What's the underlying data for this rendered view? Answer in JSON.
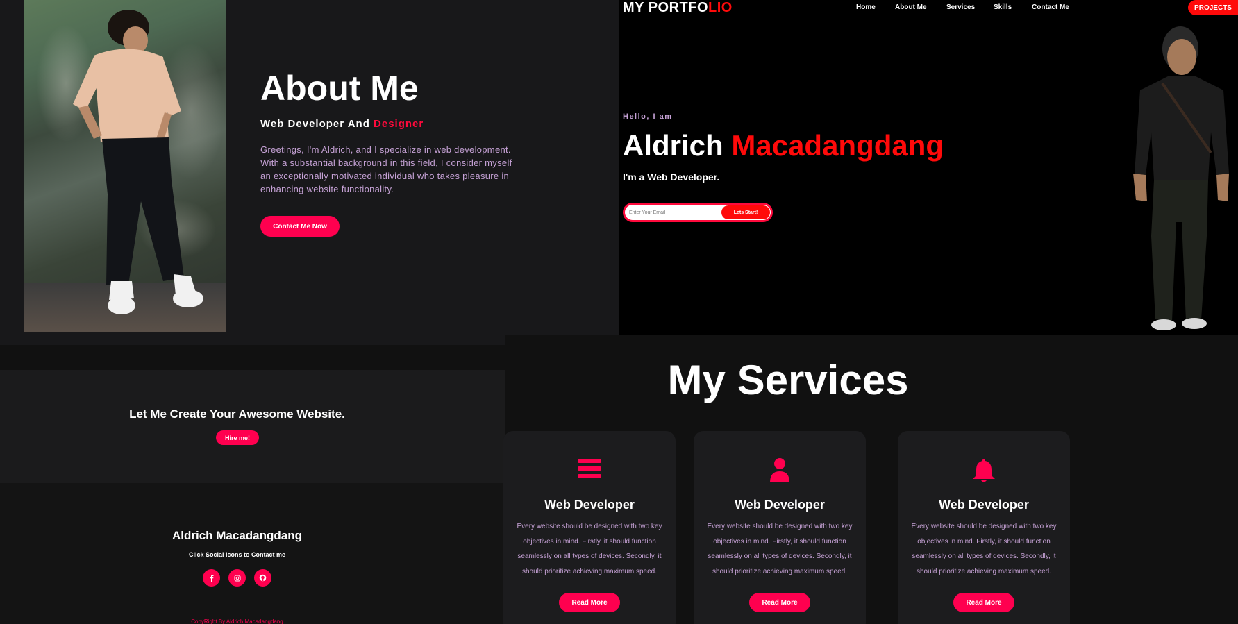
{
  "about": {
    "heading": "About Me",
    "subtitle_main": "Web Developer And ",
    "subtitle_accent": "Designer",
    "description": "Greetings, I'm Aldrich, and I specialize in web development. With a substantial background in this field, I consider myself an exceptionally motivated individual who takes pleasure in enhancing website functionality.",
    "button_label": "Contact Me Now"
  },
  "hero": {
    "logo_main": "MY PORTFO",
    "logo_accent": "LIO",
    "nav": [
      "Home",
      "About Me",
      "Services",
      "Skills",
      "Contact Me"
    ],
    "projects_label": "PROJECTS",
    "greeting": "Hello, I am",
    "first_name": "Aldrich ",
    "last_name": "Macadangdang",
    "role": "I'm a Web Developer.",
    "email_placeholder": "Enter Your Email",
    "start_label": "Lets Start!"
  },
  "cta": {
    "title": "Let Me Create Your Awesome Website.",
    "button_label": "Hire me!"
  },
  "footer": {
    "name": "Aldrich Macadangdang",
    "subtitle": "Click Social Icons to Contact me",
    "social_icons": [
      "facebook-icon",
      "instagram-icon",
      "github-icon"
    ],
    "copyright": "CopyRight By Aldrich Macadangdang"
  },
  "services": {
    "title": "My Services",
    "cards": [
      {
        "icon": "menu-bars-icon",
        "title": "Web Developer",
        "description": "Every website should be designed with two key objectives in mind. Firstly, it should function seamlessly on all types of devices. Secondly, it should prioritize achieving maximum speed.",
        "button_label": "Read More"
      },
      {
        "icon": "user-icon",
        "title": "Web Developer",
        "description": "Every website should be designed with two key objectives in mind. Firstly, it should function seamlessly on all types of devices. Secondly, it should prioritize achieving maximum speed.",
        "button_label": "Read More"
      },
      {
        "icon": "bell-icon",
        "title": "Web Developer",
        "description": "Every website should be designed with two key objectives in mind. Firstly, it should function seamlessly on all types of devices. Secondly, it should prioritize achieving maximum speed.",
        "button_label": "Read More"
      }
    ]
  },
  "colors": {
    "accent_pink": "#ff004f",
    "accent_red": "#ff0a0a",
    "text_lavender": "#c6a2d6",
    "background": "#111111"
  }
}
